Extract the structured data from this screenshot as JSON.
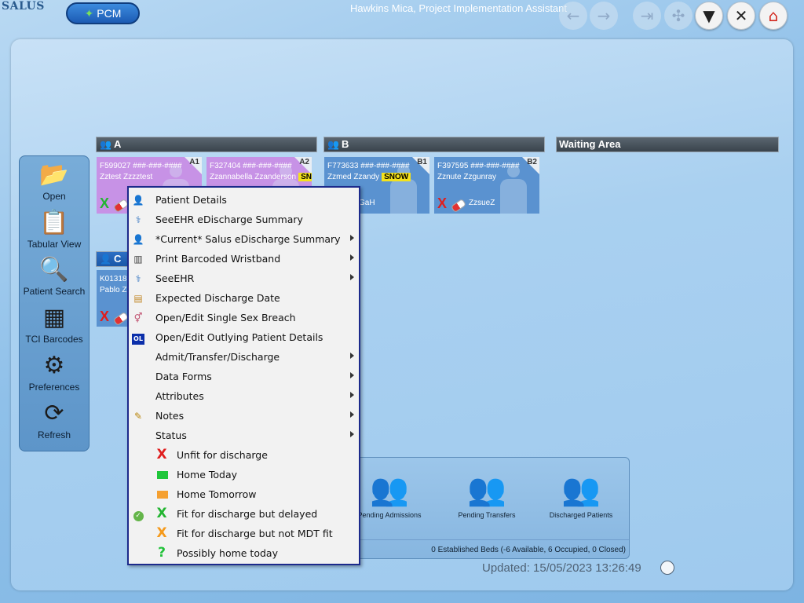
{
  "app": {
    "logo_text": "SALUS",
    "pcm_label": "PCM",
    "user_title": "Hawkins Mica, Project Implementation Assistant"
  },
  "toolbar": {
    "buttons": [
      {
        "name": "back-arrow-icon",
        "glyph": "←",
        "enabled": false
      },
      {
        "name": "forward-arrow-icon",
        "glyph": "→",
        "enabled": false
      },
      {
        "name": "exit-door-icon",
        "glyph": "⇥",
        "enabled": false
      },
      {
        "name": "network-icon",
        "glyph": "✣",
        "enabled": false
      },
      {
        "name": "filter-icon",
        "glyph": "▼",
        "enabled": true
      },
      {
        "name": "close-icon",
        "glyph": "✕",
        "enabled": true
      },
      {
        "name": "home-icon",
        "glyph": "⌂",
        "enabled": true
      }
    ]
  },
  "sidebar": {
    "items": [
      {
        "label": "Open",
        "icon": "folder-icon",
        "glyph": "📂"
      },
      {
        "label": "Tabular View",
        "icon": "clipboard-icon",
        "glyph": "📋"
      },
      {
        "label": "Patient Search",
        "icon": "magnifier-icon",
        "glyph": "🔍"
      },
      {
        "label": "TCI Barcodes",
        "icon": "qr-code-icon",
        "glyph": "▦"
      },
      {
        "label": "Preferences",
        "icon": "gear-icon",
        "glyph": "⚙"
      },
      {
        "label": "Refresh",
        "icon": "refresh-icon",
        "glyph": "⟳"
      }
    ]
  },
  "wards": {
    "a": {
      "label": "A"
    },
    "b": {
      "label": "B"
    },
    "c": {
      "label": "C"
    },
    "waiting": {
      "label": "Waiting Area"
    }
  },
  "beds": {
    "a1": {
      "bed": "A1",
      "id": "F599027  ###-###-####",
      "name": "Zztest Zzzztest",
      "color": "#c792e6"
    },
    "a2": {
      "bed": "A2",
      "id": "F327404  ###-###-####",
      "name": "Zzannabella Zzanderson",
      "flag": "SN",
      "color": "#c792e6"
    },
    "b1": {
      "bed": "B1",
      "id": "F773633  ###-###-####",
      "name": "Zzmed Zzandy",
      "flag": "SNOW",
      "consultant": "GaH",
      "color": "#5a92d0"
    },
    "b2": {
      "bed": "B2",
      "id": "F397595  ###-###-####",
      "name": "Zznute Zzgunray",
      "consultant": "ZzsueZ",
      "color": "#5a92d0"
    },
    "c1": {
      "id": "K01318",
      "name": "Pablo Z",
      "color": "#5a92d0"
    }
  },
  "admissions": {
    "items": [
      {
        "label": "Pending Admissions",
        "icon": "pending-admissions-icon"
      },
      {
        "label": "Pending Transfers",
        "icon": "pending-transfers-icon"
      },
      {
        "label": "Discharged Patients",
        "icon": "discharged-patients-icon"
      }
    ],
    "summary": "0 Established Beds (-6 Available, 6 Occupied, 0 Closed)"
  },
  "updated_text": "Updated: 15/05/2023 13:26:49",
  "context_menu": {
    "items": [
      {
        "label": "Patient Details",
        "icon": "patient-details-icon",
        "submenu": false
      },
      {
        "label": "SeeEHR eDischarge Summary",
        "icon": "seeehr-icon",
        "submenu": false
      },
      {
        "label": "*Current* Salus eDischarge Summary",
        "icon": "salus-summary-icon",
        "submenu": true
      },
      {
        "label": "Print Barcoded Wristband",
        "icon": "barcode-icon",
        "submenu": true
      },
      {
        "label": "SeeEHR",
        "icon": "seeehr-icon",
        "submenu": true
      },
      {
        "label": "Expected Discharge Date",
        "icon": "calendar-icon",
        "submenu": false
      },
      {
        "label": "Open/Edit Single Sex Breach",
        "icon": "gender-icon",
        "submenu": false
      },
      {
        "label": "Open/Edit Outlying Patient Details",
        "icon": "outlier-icon",
        "icon_text": "OL",
        "submenu": false
      },
      {
        "label": "Admit/Transfer/Discharge",
        "icon": "",
        "submenu": true
      },
      {
        "label": "Data Forms",
        "icon": "",
        "submenu": true
      },
      {
        "label": "Attributes",
        "icon": "",
        "submenu": true
      },
      {
        "label": "Notes",
        "icon": "notes-icon",
        "submenu": true
      },
      {
        "label": "Status",
        "icon": "",
        "submenu": true
      }
    ],
    "statuses": [
      {
        "label": "Unfit for discharge",
        "mark": "X",
        "color": "#e01e1e",
        "kind": "mark",
        "checked": false
      },
      {
        "label": "Home Today",
        "mark": "",
        "color": "#1fc63a",
        "kind": "square",
        "checked": false
      },
      {
        "label": "Home Tomorrow",
        "mark": "",
        "color": "#f5a030",
        "kind": "square",
        "checked": false
      },
      {
        "label": "Fit for discharge but delayed",
        "mark": "X",
        "color": "#23b531",
        "kind": "mark",
        "checked": true
      },
      {
        "label": "Fit for discharge but not MDT fit",
        "mark": "X",
        "color": "#f59a1c",
        "kind": "mark",
        "checked": false
      },
      {
        "label": "Possibly home today",
        "mark": "?",
        "color": "#22c23a",
        "kind": "mark",
        "checked": false
      }
    ]
  }
}
